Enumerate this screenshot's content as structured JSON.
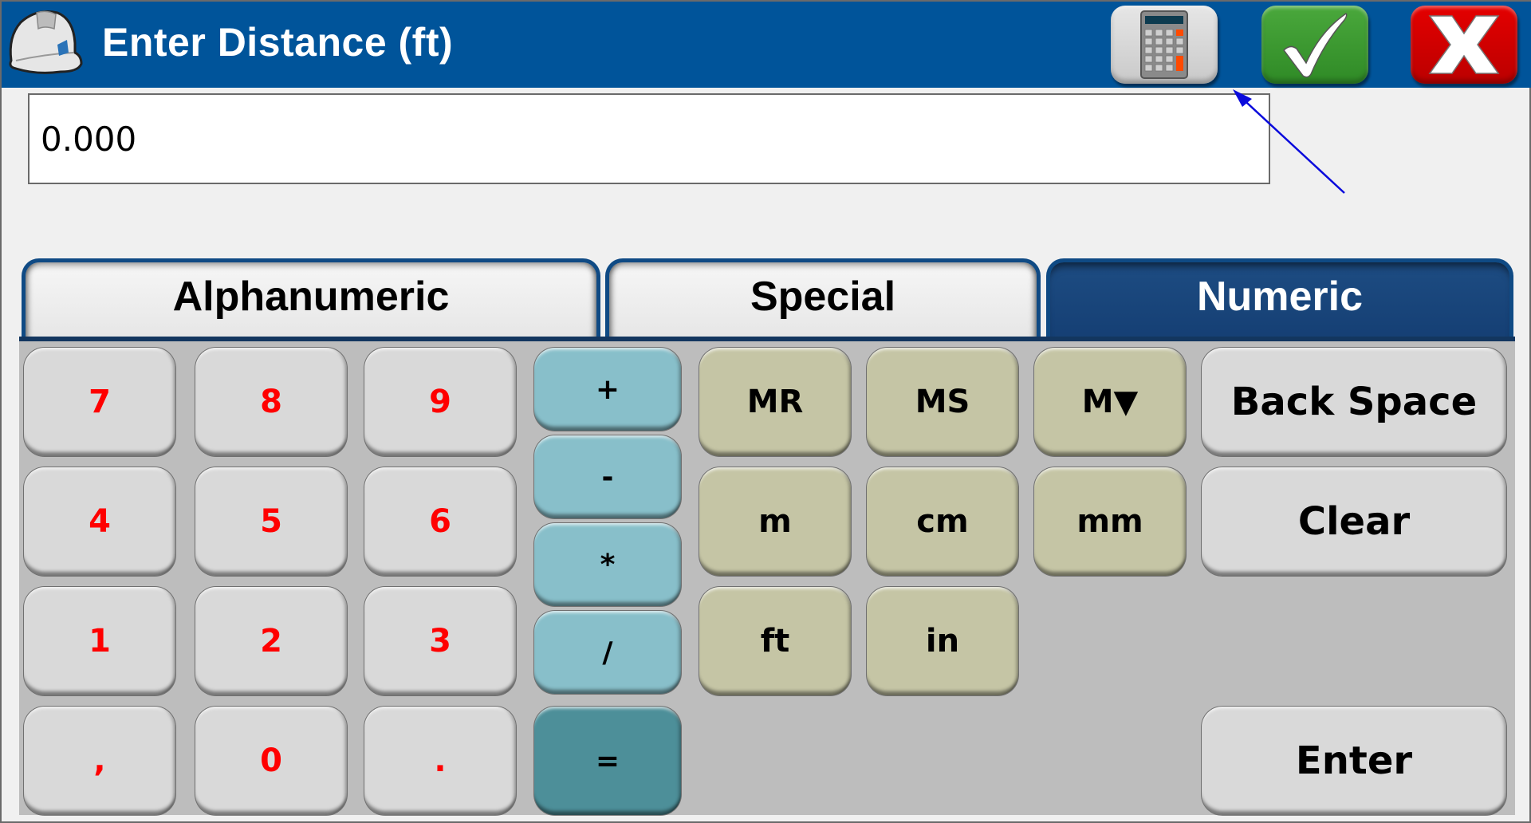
{
  "header": {
    "title": "Enter Distance (ft)",
    "logo_icon": "hardhat-icon",
    "buttons": [
      {
        "name": "calculator",
        "icon": "calculator-icon"
      },
      {
        "name": "accept",
        "icon": "checkmark-icon",
        "color": "#3a9b2f"
      },
      {
        "name": "cancel",
        "icon": "close-x-icon",
        "color": "#d80000"
      }
    ],
    "bg_color": "#00549a"
  },
  "input": {
    "value": "0.000"
  },
  "tabs": [
    {
      "label": "Alphanumeric",
      "active": false
    },
    {
      "label": "Special",
      "active": false
    },
    {
      "label": "Numeric",
      "active": true
    }
  ],
  "keypad": {
    "digits": [
      "7",
      "8",
      "9",
      "4",
      "5",
      "6",
      "1",
      "2",
      "3",
      ",",
      "0",
      "."
    ],
    "operators": [
      "+",
      "-",
      "*",
      "/",
      "="
    ],
    "memory": [
      "MR",
      "MS",
      "M▼"
    ],
    "units": [
      "m",
      "cm",
      "mm",
      "ft",
      "in"
    ],
    "actions": {
      "backspace": "Back Space",
      "clear": "Clear",
      "enter": "Enter"
    },
    "digit_color": "#ff0000",
    "operator_color": "#88bfca",
    "equals_color": "#4d8f99",
    "unit_color": "#c5c5a5"
  }
}
